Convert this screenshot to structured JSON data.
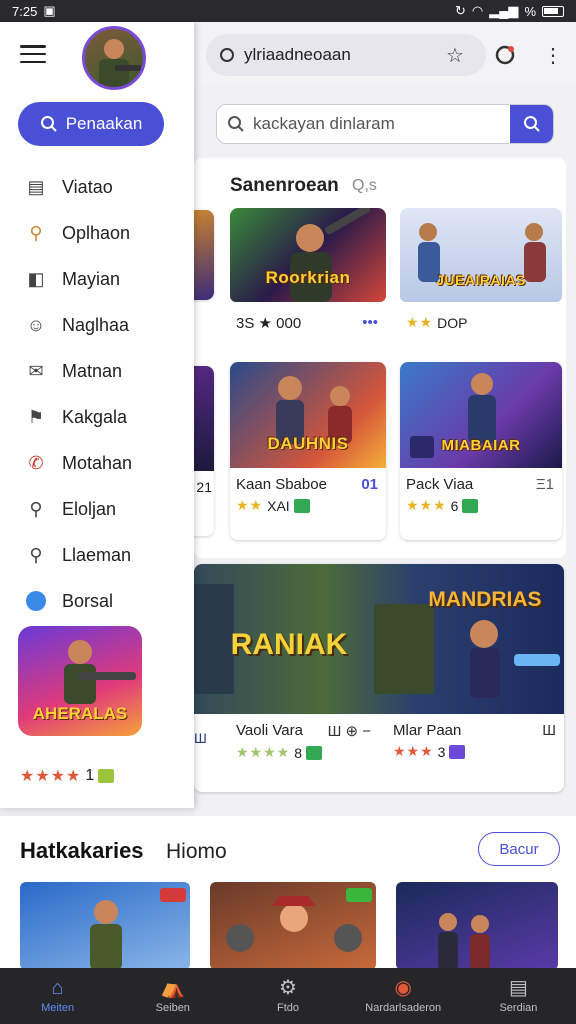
{
  "status": {
    "time": "7:25",
    "battery": "%"
  },
  "topbar": {
    "url_text": "ylriaadneoaan"
  },
  "search": {
    "placeholder": "kackayan dinlaram"
  },
  "drawer": {
    "primary_button": "Penaakan",
    "items": [
      {
        "label": "Viatao",
        "icon": "news-icon"
      },
      {
        "label": "Oplhaon",
        "icon": "search-tool-icon"
      },
      {
        "label": "Mayian",
        "icon": "panel-icon"
      },
      {
        "label": "Naglhaa",
        "icon": "smile-icon"
      },
      {
        "label": "Matnan",
        "icon": "mail-icon"
      },
      {
        "label": "Kakgala",
        "icon": "flag-icon"
      },
      {
        "label": "Motahan",
        "icon": "phone-icon"
      },
      {
        "label": "Eloljan",
        "icon": "search-icon"
      },
      {
        "label": "Llaeman",
        "icon": "search-icon"
      },
      {
        "label": "Borsal",
        "icon": "circle-icon"
      }
    ],
    "promo_title": "AHERALAS",
    "promo_rating": "1"
  },
  "main": {
    "section_title": "Sanenroean",
    "section_sub": "Q,s",
    "tiles": [
      {
        "art_title": "Roorkrian",
        "name": "3S ★ 000",
        "meta": ""
      },
      {
        "art_title": "JUEAIRAIAS",
        "name": "DOP",
        "meta": ""
      },
      {
        "art_title": "DAUHNIS",
        "name": "Kaan Sbaboe",
        "meta": "01",
        "rating": "XAI"
      },
      {
        "art_title": "MIABAIAR",
        "name": "Pack Viaa",
        "meta": "Ξ1",
        "rating": "6"
      }
    ],
    "left_edge_labels": [
      "21",
      "Ш"
    ],
    "banner": {
      "left_title": "RANIAK",
      "right_title": "MANDRIAS",
      "left_name": "Vaoli Vara",
      "left_meta": "Ш ⊕ −",
      "left_rating": "8",
      "right_name": "Mlar Paan",
      "right_meta": "Ш",
      "right_rating": "3"
    }
  },
  "bottom_section": {
    "title": "Hatkakaries",
    "subtitle": "Hiomo",
    "button": "Bacur"
  },
  "bottom_nav": [
    {
      "label": "Meiten",
      "icon": "home-icon",
      "active": true
    },
    {
      "label": "Seiben",
      "icon": "shop-icon",
      "active": false
    },
    {
      "label": "Ftdo",
      "icon": "settings-icon",
      "active": false
    },
    {
      "label": "Nardarlsaderon",
      "icon": "notifications-icon",
      "active": false
    },
    {
      "label": "Serdian",
      "icon": "list-icon",
      "active": false
    }
  ]
}
